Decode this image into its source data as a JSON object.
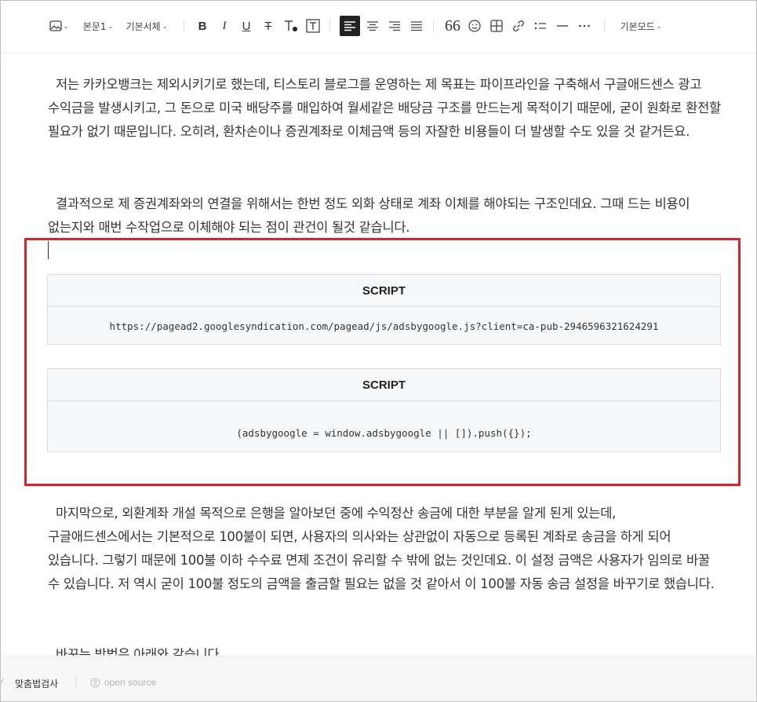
{
  "toolbar": {
    "paragraph_style": "본문1",
    "font_family": "기본서체",
    "mode": "기본모드"
  },
  "content": {
    "paragraph1": "저는 카카오뱅크는 제외시키기로 했는데, 티스토리 블로그를 운영하는 제 목표는 파이프라인을 구축해서 구글애드센스 광고 수익금을 발생시키고, 그 돈으로 미국 배당주를 매입하여 월세같은 배당금 구조를 만드는게 목적이기 때문에, 굳이 원화로 환전할 필요가 없기 때문입니다. 오히려, 환차손이나 증권계좌로 이체금액 등의 자잘한 비용들이 더 발생할 수도 있을 것 같거든요.",
    "paragraph2": "결과적으로 제 증권계좌와의 연결을 위해서는 한번 정도 외화 상태로 계좌 이체를 해야되는 구조인데요. 그때 드는 비용이 없는지와 매번 수작업으로 이체해야 되는 점이 관건이 될것 같습니다.",
    "paragraph3": "마지막으로, 외환계좌 개설 목적으로 은행을 알아보던 중에 수익정산 송금에 대한 부분을 알게 된게 있는데, 구글애드센스에서는 기본적으로 100불이 되면, 사용자의 의사와는 상관없이 자동으로 등록된 계좌로 송금을 하게 되어 있습니다. 그렇기 때문에 100불 이하 수수료 면제 조건이 유리할 수 밖에 없는 것인데요. 이 설정 금액은 사용자가 임의로 바꿀 수 있습니다. 저 역시 굳이 100불 정도의 금액을 출금할 필요는 없을 것 같아서 이 100불 자동 송금 설정을 바꾸기로 했습니다.",
    "paragraph4": "바꾸는 방법은 아래와 같습니다."
  },
  "scripts": [
    {
      "label": "SCRIPT",
      "code": "https://pagead2.googlesyndication.com/pagead/js/adsbygoogle.js?client=ca-pub-2946596321624291"
    },
    {
      "label": "SCRIPT",
      "code": "(adsbygoogle = window.adsbygoogle || []).push({});"
    }
  ],
  "highlight_color": "#e0202a",
  "footer": {
    "spellcheck": "맞춤법검사",
    "open_source": "open source"
  }
}
